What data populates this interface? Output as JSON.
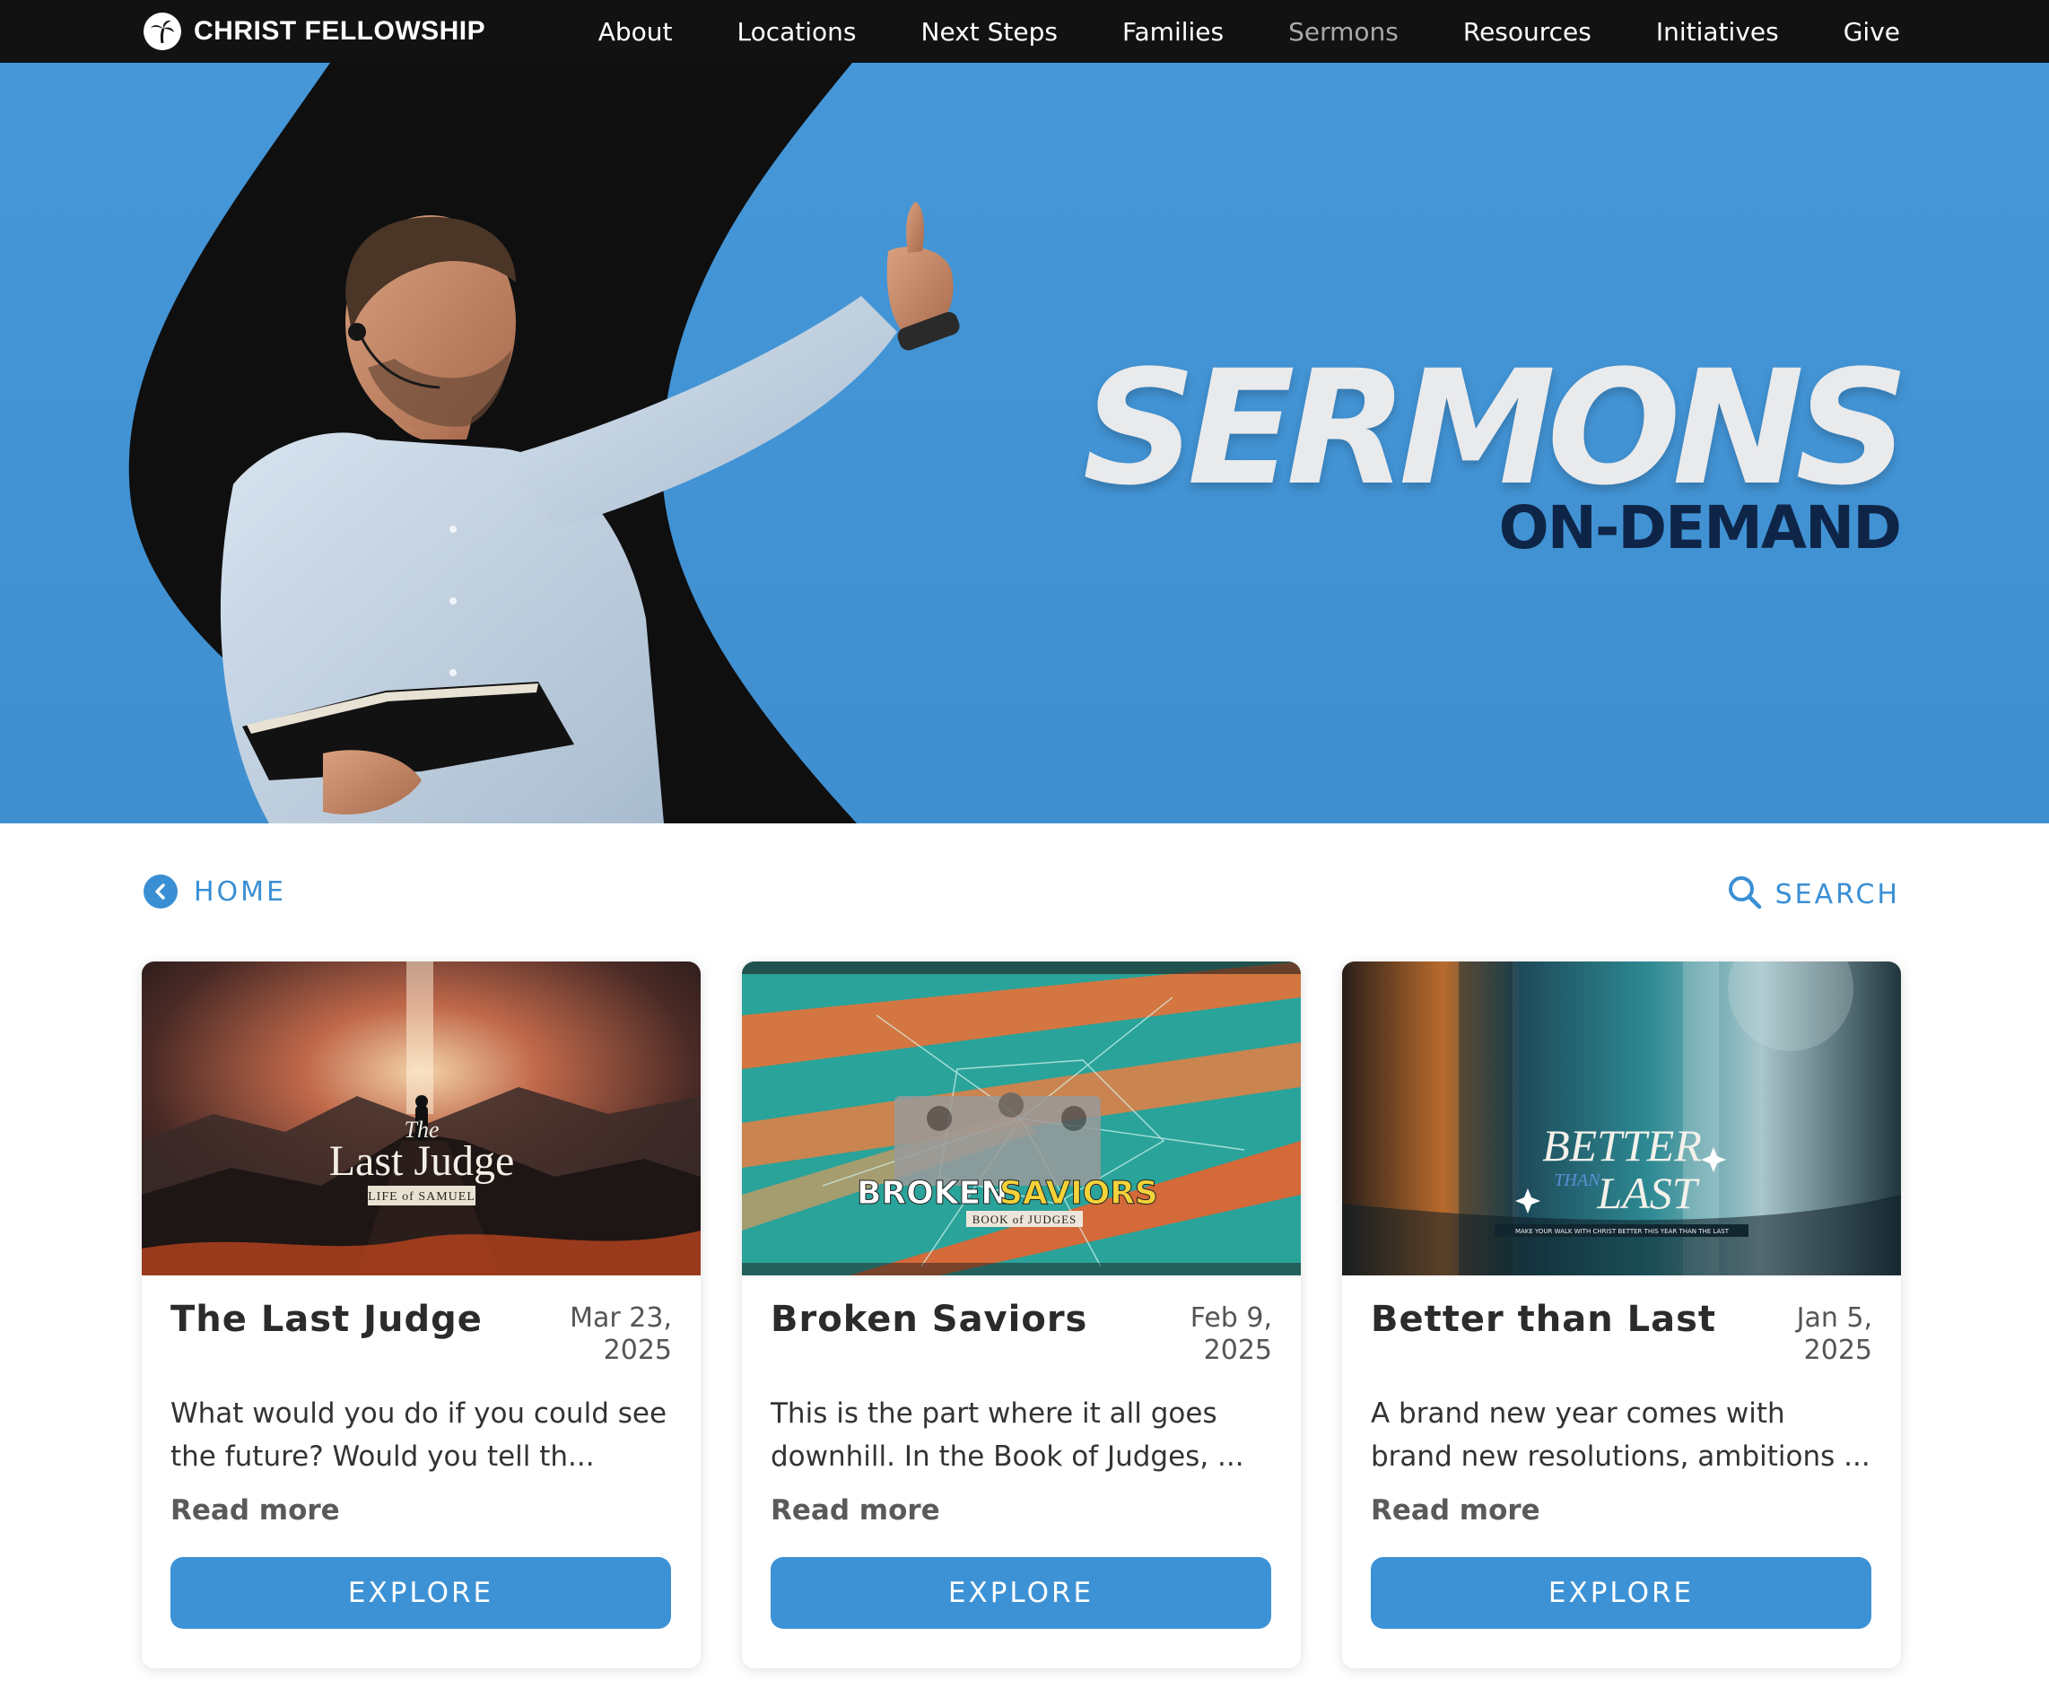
{
  "nav": {
    "brand": "CHRIST FELLOWSHIP",
    "links": [
      {
        "label": "About",
        "active": false
      },
      {
        "label": "Locations",
        "active": false
      },
      {
        "label": "Next Steps",
        "active": false
      },
      {
        "label": "Families",
        "active": false
      },
      {
        "label": "Sermons",
        "active": true
      },
      {
        "label": "Resources",
        "active": false
      },
      {
        "label": "Initiatives",
        "active": false
      },
      {
        "label": "Give",
        "active": false
      }
    ]
  },
  "hero": {
    "title": "SERMONS",
    "subtitle": "ON-DEMAND",
    "bg_color": "#4597d8",
    "subtitle_color": "#0e2547"
  },
  "utility": {
    "home_label": "HOME",
    "search_label": "SEARCH",
    "accent": "#3a8fd4"
  },
  "cards": [
    {
      "title": "The Last Judge",
      "date": "Mar 23, 2025",
      "description": "What would you do if you could see the future? Would you tell th...",
      "read_more": "Read more",
      "button": "EXPLORE",
      "thumb_title": "Last Judge",
      "thumb_prefix": "The",
      "thumb_sub": "LIFE of SAMUEL"
    },
    {
      "title": "Broken Saviors",
      "date": "Feb 9, 2025",
      "description": "This is the part where it all goes downhill. In the Book of Judges, ...",
      "read_more": "Read more",
      "button": "EXPLORE",
      "thumb_title_a": "BROKEN",
      "thumb_title_b": "SAVIORS",
      "thumb_sub": "BOOK of JUDGES"
    },
    {
      "title": "Better than Last",
      "date": "Jan 5, 2025",
      "description": "A brand new year comes with brand new resolutions, ambitions ...",
      "read_more": "Read more",
      "button": "EXPLORE",
      "thumb_title_a": "BETTER",
      "thumb_mid": "THAN",
      "thumb_title_b": "LAST",
      "thumb_sub": "MAKE YOUR WALK WITH CHRIST BETTER THIS YEAR THAN THE LAST"
    }
  ],
  "accent_button": "#3d92d5"
}
